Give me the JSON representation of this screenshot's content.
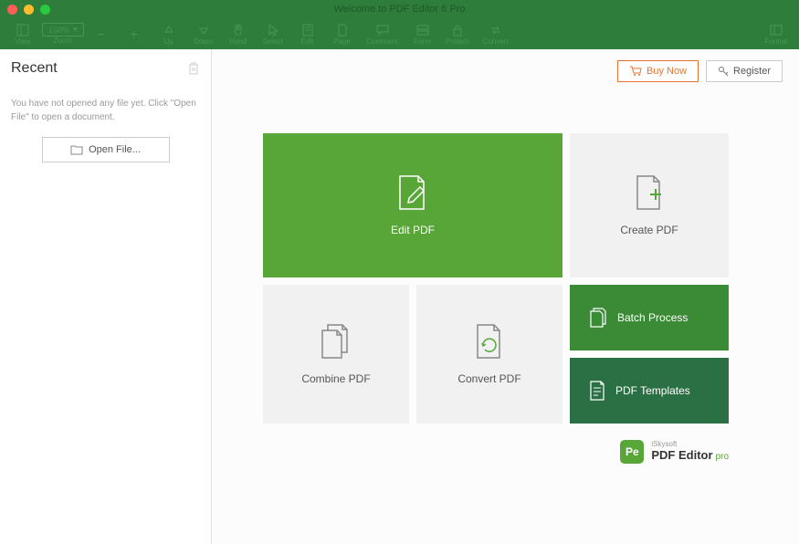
{
  "title": "Welcome to PDF Editor 6 Pro",
  "toolbar": {
    "view": "View",
    "zoom": "Zoom",
    "zoom_value": "100%",
    "up": "Up",
    "down": "Down",
    "hand": "Hand",
    "select": "Select",
    "edit": "Edit",
    "page": "Page",
    "comment": "Comment",
    "form": "Form",
    "protect": "Protect",
    "convert": "Convert",
    "format": "Format"
  },
  "sidebar": {
    "title": "Recent",
    "description": "You have not opened any file yet. Click \"Open File\" to open a document.",
    "open_file": "Open File..."
  },
  "actions": {
    "buy_now": "Buy Now",
    "register": "Register"
  },
  "tiles": {
    "edit": "Edit PDF",
    "create": "Create PDF",
    "combine": "Combine PDF",
    "convert": "Convert PDF",
    "batch": "Batch Process",
    "templates": "PDF Templates"
  },
  "brand": {
    "badge": "Pe",
    "company": "iSkysoft",
    "product": "PDF Editor",
    "suffix": "pro"
  }
}
